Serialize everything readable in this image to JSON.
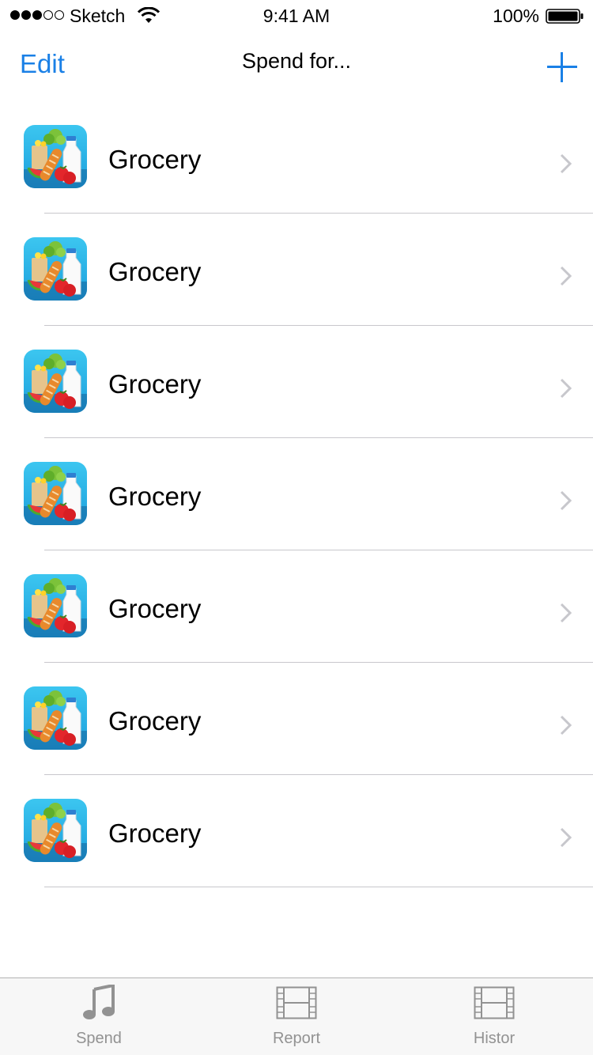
{
  "status_bar": {
    "carrier": "Sketch",
    "time": "9:41 AM",
    "battery": "100%",
    "signal_icon": "signal-dots-icon",
    "wifi_icon": "wifi-icon",
    "battery_icon": "battery-icon"
  },
  "nav": {
    "edit_label": "Edit",
    "title": "Spend for...",
    "add_icon": "plus-icon",
    "accent_color": "#1a80e6"
  },
  "list": {
    "items": [
      {
        "label": "Grocery",
        "icon": "grocery-icon"
      },
      {
        "label": "Grocery",
        "icon": "grocery-icon"
      },
      {
        "label": "Grocery",
        "icon": "grocery-icon"
      },
      {
        "label": "Grocery",
        "icon": "grocery-icon"
      },
      {
        "label": "Grocery",
        "icon": "grocery-icon"
      },
      {
        "label": "Grocery",
        "icon": "grocery-icon"
      },
      {
        "label": "Grocery",
        "icon": "grocery-icon"
      }
    ]
  },
  "tabs": [
    {
      "label": "Spend",
      "icon": "music-note-icon"
    },
    {
      "label": "Report",
      "icon": "film-icon"
    },
    {
      "label": "Histor",
      "icon": "film-icon"
    }
  ]
}
